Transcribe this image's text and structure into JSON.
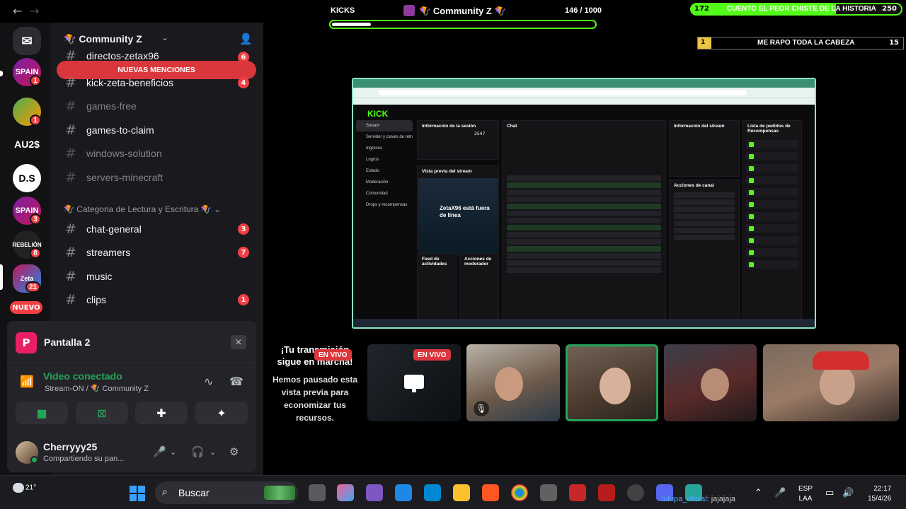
{
  "topbar": {
    "kicks_label": "KICKS",
    "server_title": "Community Z",
    "kicks_count": "146 / 1000",
    "kicks_progress": 0.146,
    "goal1": {
      "current": "172",
      "label": "CUENTO EL PEOR CHISTE DE LA HISTORIA",
      "target": "250",
      "progress": 0.688
    },
    "goal2": {
      "current": "1",
      "label": "ME RAPO TODA LA CABEZA",
      "target": "15",
      "progress": 0.067
    }
  },
  "rail": {
    "servers": [
      {
        "name": "discord-home",
        "label": "",
        "badge": ""
      },
      {
        "name": "spain-server",
        "label": "SPAIN",
        "badge": "1"
      },
      {
        "name": "game-server",
        "label": "",
        "badge": "1"
      },
      {
        "name": "au2-server",
        "label": "AU2$",
        "badge": ""
      },
      {
        "name": "ds-server",
        "label": "D.S",
        "badge": ""
      },
      {
        "name": "spain-server-2",
        "label": "SPAIN",
        "badge": "3"
      },
      {
        "name": "rebelion-server",
        "label": "REBELIÓN",
        "badge": "8"
      },
      {
        "name": "zeta-server",
        "label": "Zeta",
        "badge": "21"
      }
    ],
    "nuevo": "NUEVO"
  },
  "channels": {
    "server_name": "Community Z",
    "mentions_banner": "NUEVAS MENCIONES",
    "list": [
      {
        "label": "directos-zetax96",
        "badge": "6",
        "muted": false
      },
      {
        "label": "kick-zeta-beneficios",
        "badge": "4",
        "muted": false
      },
      {
        "label": "games-free",
        "badge": "",
        "muted": true
      },
      {
        "label": "games-to-claim",
        "badge": "",
        "muted": false
      },
      {
        "label": "windows-solution",
        "badge": "",
        "muted": true
      },
      {
        "label": "servers-minecraft",
        "badge": "",
        "muted": true
      }
    ],
    "category2": "Categoria de Lectura y Escritura",
    "list2": [
      {
        "label": "chat-general",
        "badge": "3"
      },
      {
        "label": "streamers",
        "badge": "7"
      },
      {
        "label": "music",
        "badge": ""
      },
      {
        "label": "clips",
        "badge": "1"
      }
    ]
  },
  "voice": {
    "screen_name": "Pantalla 2",
    "screen_initial": "P",
    "status": "Video conectado",
    "channel": "Stream-ON",
    "server": "Community Z",
    "separator": "/"
  },
  "user": {
    "name": "Cherryyy25",
    "status": "Compartiendo su pan..."
  },
  "stream": {
    "kick_logo": "KICK",
    "sidebar": [
      "Stream",
      "Servidor y claves de retransm",
      "Ingresos",
      "Logros",
      "Estado",
      "Moderación",
      "Comunidad",
      "Drops y recompensas"
    ],
    "session_title": "Información de la sesión",
    "chat_title": "Chat",
    "info_title": "Información del stream",
    "requests_title": "Lista de pedidos de Recompensas",
    "preview_title": "Vista previa del stream",
    "offline_text": "ZetaX96 está fuera de línea",
    "channel_actions": "Acciones de canal",
    "activity_feed": "Feed de actividades",
    "mod_actions": "Acciones de moderador",
    "viewers": "2547"
  },
  "paused": {
    "title": "¡Tu transmisión sigue en marcha!",
    "body": "Hemos pausado esta vista previa para economizar tus recursos."
  },
  "live_label": "EN VIVO",
  "taskbar": {
    "temp": "21°",
    "search": "Buscar",
    "tray_user": "lulupa_oficial",
    "tray_msg": ": jajajaja",
    "lang1": "ESP",
    "lang2": "LAA",
    "time": "22:17",
    "date": "15/4/26"
  },
  "colors": {
    "kick_green": "#53fc18",
    "discord_red": "#f23f43",
    "discord_green": "#23a559",
    "bg": "#1a1a1e"
  }
}
